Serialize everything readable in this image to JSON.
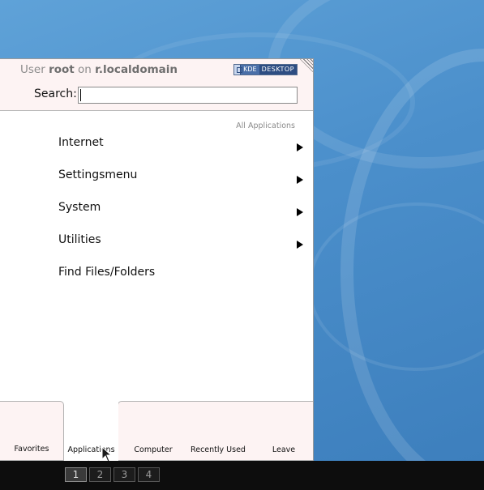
{
  "header": {
    "user_prefix": "User",
    "username": "root",
    "on_text": "on",
    "hostname": "r.localdomain",
    "badge_left": "KDE",
    "badge_right": "DESKTOP"
  },
  "search": {
    "label": "Search:",
    "value": ""
  },
  "breadcrumb": "All Applications",
  "menu": {
    "items": [
      {
        "label": "Internet",
        "has_submenu": true
      },
      {
        "label": "Settingsmenu",
        "has_submenu": true
      },
      {
        "label": "System",
        "has_submenu": true
      },
      {
        "label": "Utilities",
        "has_submenu": true
      },
      {
        "label": "Find Files/Folders",
        "has_submenu": false
      }
    ]
  },
  "tabs": {
    "favorites": "Favorites",
    "applications": "Applications",
    "computer": "Computer",
    "recently_used": "Recently Used",
    "leave": "Leave",
    "active": "Applications"
  },
  "panel": {
    "desktops": [
      "1",
      "2",
      "3",
      "4"
    ],
    "active_desktop": "1"
  },
  "colors": {
    "desktop_blue": "#4b8fcb",
    "menu_header_bg": "#fdf3f3",
    "panel_bg": "#0d0d0d",
    "badge_blue": "#2d4d82"
  }
}
